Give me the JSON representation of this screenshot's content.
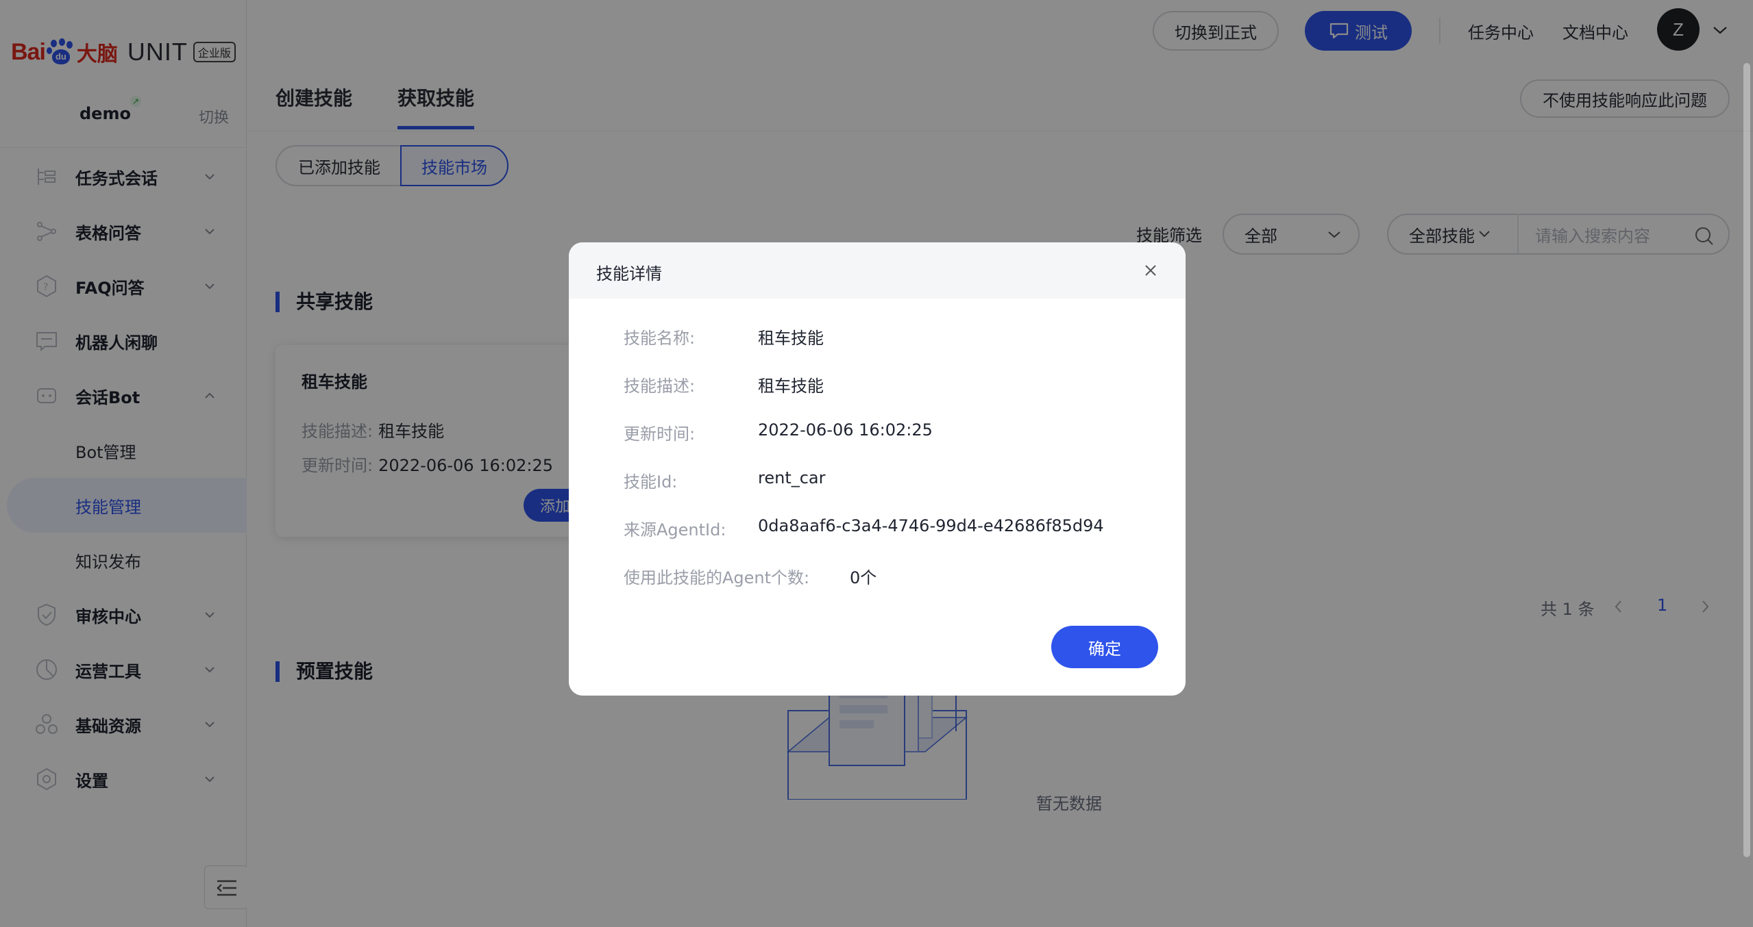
{
  "logo": {
    "bai": "Bai",
    "du": "du",
    "danao": "大脑",
    "unit": "UNIT",
    "edition": "企业版"
  },
  "project": {
    "name": "demo",
    "switch": "切换"
  },
  "sidebar": {
    "items": [
      {
        "label": "任务式会话",
        "icon": "task-dialog-icon",
        "expanded": false
      },
      {
        "label": "表格问答",
        "icon": "table-qa-icon",
        "expanded": false
      },
      {
        "label": "FAQ问答",
        "icon": "faq-icon",
        "expanded": false
      },
      {
        "label": "机器人闲聊",
        "icon": "chat-icon"
      },
      {
        "label": "会话Bot",
        "icon": "bot-icon",
        "expanded": true
      },
      {
        "label": "Bot管理"
      },
      {
        "label": "技能管理",
        "active": true
      },
      {
        "label": "知识发布"
      },
      {
        "label": "审核中心",
        "icon": "shield-icon",
        "expanded": false
      },
      {
        "label": "运营工具",
        "icon": "ops-icon",
        "expanded": false
      },
      {
        "label": "基础资源",
        "icon": "resource-icon",
        "expanded": false
      },
      {
        "label": "设置",
        "icon": "gear-icon",
        "expanded": false
      }
    ]
  },
  "topbar": {
    "switch_formal": "切换到正式",
    "test": "测试",
    "task_center": "任务中心",
    "doc_center": "文档中心",
    "avatar": "Z"
  },
  "tabs": {
    "create": "创建技能",
    "get": "获取技能",
    "no_skill": "不使用技能响应此问题"
  },
  "segment": {
    "added": "已添加技能",
    "market": "技能市场"
  },
  "filter": {
    "label": "技能筛选",
    "value": "全部",
    "scope": "全部技能",
    "search_placeholder": "请输入搜索内容"
  },
  "shared": {
    "title": "共享技能",
    "card": {
      "title": "租车技能",
      "desc_key": "技能描述:",
      "desc_val": "租车技能",
      "time_key": "更新时间:",
      "time_val": "2022-06-06 16:02:25",
      "add": "添加"
    }
  },
  "pager": {
    "total": "共 1 条",
    "page": "1"
  },
  "preset": {
    "title": "预置技能",
    "empty": "暂无数据"
  },
  "modal": {
    "title": "技能详情",
    "rows": [
      {
        "key": "技能名称:",
        "value": "租车技能"
      },
      {
        "key": "技能描述:",
        "value": "租车技能"
      },
      {
        "key": "更新时间:",
        "value": "2022-06-06 16:02:25"
      },
      {
        "key": "技能Id:",
        "value": "rent_car"
      },
      {
        "key": "来源AgentId:",
        "value": "0da8aaf6-c3a4-4746-99d4-e42686f85d94"
      },
      {
        "key": "使用此技能的Agent个数:",
        "value": "0个"
      }
    ],
    "ok": "确定"
  },
  "colors": {
    "primary": "#2f54eb",
    "brand_red": "#de2a1f"
  }
}
